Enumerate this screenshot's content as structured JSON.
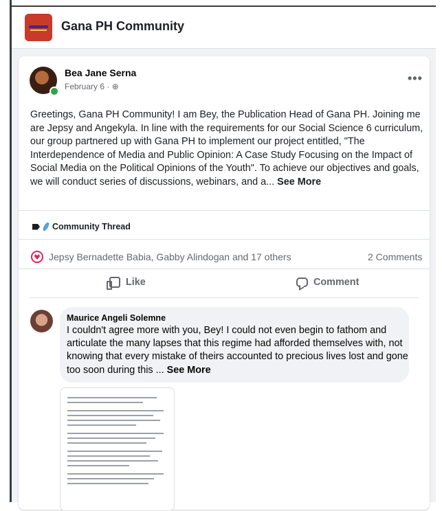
{
  "group": {
    "name": "Gana PH Community"
  },
  "post": {
    "author": "Bea Jane Serna",
    "date": "February 6",
    "privacy_icon": "globe-icon",
    "more_label": "•••",
    "text": "Greetings, Gana PH Community! I am Bey, the Publication Head of Gana PH. Joining me are Jepsy and Angekyla. In line with the requirements for our Social Science 6 curriculum, our group partnered up with Gana PH to implement our project entitled, \"The Interdependence of Media and Public Opinion: A Case Study Focusing on the Impact of Social Media on the Political Opinions of the Youth\". To achieve our objectives and goals, we will conduct series of discussions, webinars, and a...",
    "see_more": "See More",
    "tag": "Community Thread",
    "reactions_text": "Jepsy Bernadette Babia, Gabby Alindogan and 17 others",
    "comments_count": "2 Comments",
    "like_label": "Like",
    "comment_label": "Comment"
  },
  "comment": {
    "author": "Maurice Angeli Solemne",
    "text": "I couldn't agree more with you, Bey! I could not even begin to fathom and articulate the many lapses that this regime had afforded themselves with, not knowing that every mistake of theirs accounted to precious lives lost and gone too soon during this ...",
    "see_more": "See More"
  },
  "colors": {
    "accent_heart": "#e0245e",
    "online": "#31a24c",
    "group_logo": "#c83a2a"
  }
}
